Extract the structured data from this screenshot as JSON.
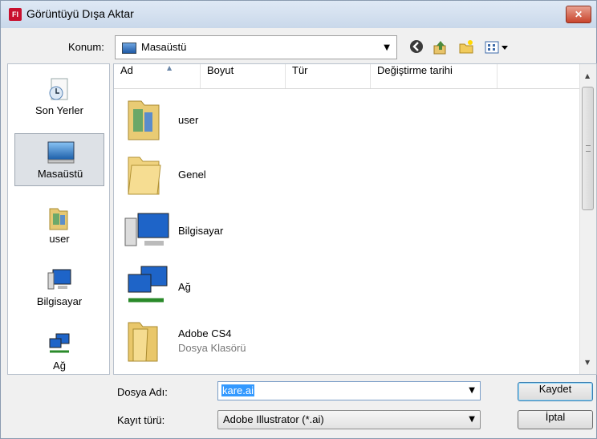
{
  "window": {
    "title": "Görüntüyü Dışa Aktar",
    "app_icon_text": "Fl",
    "close_label": "✕"
  },
  "location": {
    "label": "Konum:",
    "value": "Masaüstü"
  },
  "toolbar": {
    "back_icon": "back-arrow-icon",
    "up_icon": "up-folder-icon",
    "new_folder_icon": "new-folder-icon",
    "views_icon": "view-menu-icon"
  },
  "places": [
    {
      "label": "Son Yerler",
      "icon": "recent-places-icon"
    },
    {
      "label": "Masaüstü",
      "icon": "desktop-icon",
      "selected": true
    },
    {
      "label": "user",
      "icon": "user-folder-icon"
    },
    {
      "label": "Bilgisayar",
      "icon": "computer-icon"
    },
    {
      "label": "Ağ",
      "icon": "network-icon"
    }
  ],
  "columns": [
    "Ad",
    "Boyut",
    "Tür",
    "Değiştirme tarihi"
  ],
  "files": [
    {
      "name": "user",
      "icon": "user-folder-icon"
    },
    {
      "name": "Genel",
      "icon": "folder-icon"
    },
    {
      "name": "Bilgisayar",
      "icon": "computer-icon"
    },
    {
      "name": "Ağ",
      "icon": "network-icon"
    },
    {
      "name": "Adobe CS4",
      "subtitle": "Dosya Klasörü",
      "icon": "folder-icon"
    }
  ],
  "form": {
    "filename_label": "Dosya Adı:",
    "filename_value": "kare.ai",
    "type_label": "Kayıt türü:",
    "type_value": "Adobe Illustrator (*.ai)"
  },
  "buttons": {
    "save": "Kaydet",
    "cancel": "İptal"
  },
  "colors": {
    "selection": "#3399ff",
    "title_bar": "#c9d8ea",
    "close_button": "#c9442d"
  }
}
